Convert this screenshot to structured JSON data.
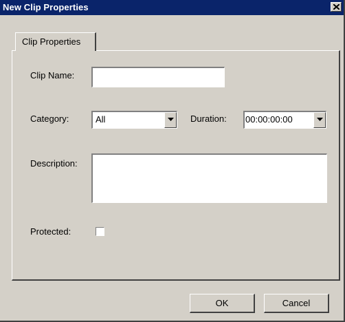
{
  "window": {
    "title": "New Clip Properties"
  },
  "tabs": [
    {
      "label": "Clip Properties"
    }
  ],
  "form": {
    "clip_name": {
      "label": "Clip Name:",
      "value": ""
    },
    "category": {
      "label": "Category:",
      "value": "All"
    },
    "duration": {
      "label": "Duration:",
      "value": "00:00:00:00"
    },
    "description": {
      "label": "Description:",
      "value": ""
    },
    "protected": {
      "label": "Protected:",
      "checked": false
    }
  },
  "buttons": {
    "ok": "OK",
    "cancel": "Cancel"
  },
  "icons": {
    "close": "close-icon",
    "dropdown": "chevron-down-icon"
  },
  "colors": {
    "titlebar": "#0a246a",
    "face": "#d4d0c8"
  }
}
